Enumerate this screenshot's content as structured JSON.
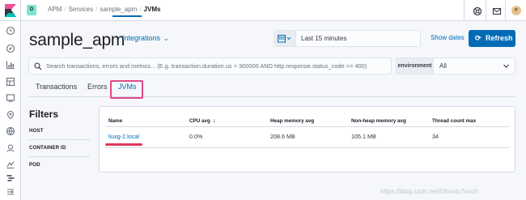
{
  "header": {
    "space_initial": "D",
    "breadcrumbs": [
      "APM",
      "Services",
      "sample_apm"
    ],
    "breadcrumb_current": "JVMs",
    "avatar_initial": "e"
  },
  "page": {
    "title": "sample_apm",
    "integrations_label": "Integrations",
    "time_range": "Last 15 minutes",
    "show_dates_label": "Show dates",
    "refresh_label": "Refresh"
  },
  "search": {
    "placeholder": "Search transactions, errors and metrics... (E.g. transaction.duration.us > 300000 AND http.response.status_code >= 400)"
  },
  "environment": {
    "label": "environment",
    "value": "All"
  },
  "tabs": [
    {
      "label": "Transactions",
      "selected": false
    },
    {
      "label": "Errors",
      "selected": false
    },
    {
      "label": "JVMs",
      "selected": true
    }
  ],
  "filters": {
    "title": "Filters",
    "items": [
      "HOST",
      "CONTAINER ID",
      "POD"
    ]
  },
  "table": {
    "columns": [
      "Name",
      "CPU avg",
      "Heap memory avg",
      "Non-heap memory avg",
      "Thread count max"
    ],
    "rows": [
      {
        "name": "liuxg-2.local",
        "cpu_avg": "0.0%",
        "heap_memory_avg": "208.6 MB",
        "non_heap_memory_avg": "105.1 MB",
        "thread_count_max": "34"
      }
    ]
  },
  "watermark": "https://blog.csdn.net/UbuntuTouch",
  "colors": {
    "accent": "#006bb4",
    "highlight": "#e0488b",
    "annotation": "#d6163c"
  }
}
